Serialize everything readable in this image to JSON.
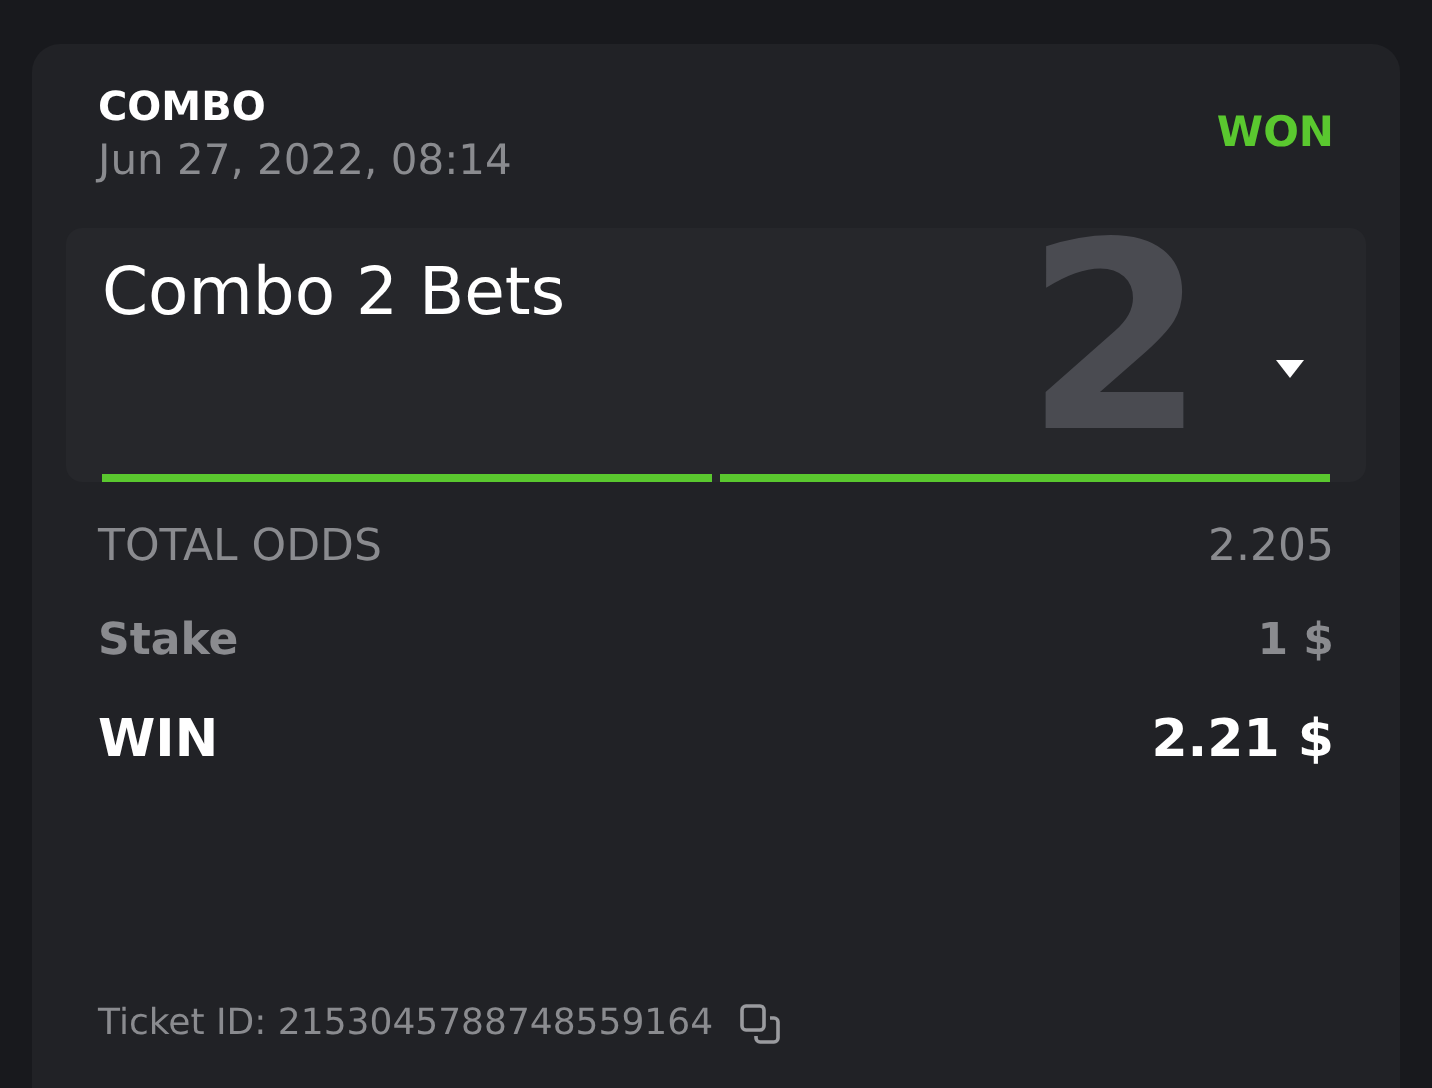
{
  "header": {
    "type": "COMBO",
    "date": "Jun 27, 2022, 08:14",
    "status": {
      "label": "WON",
      "kind": "won"
    }
  },
  "combo": {
    "title": "Combo 2 Bets",
    "count": "2",
    "expanded": false,
    "legs": [
      {
        "color": "#5ac82f"
      },
      {
        "color": "#5ac82f"
      }
    ]
  },
  "rows": [
    {
      "kind": "odds",
      "label": "TOTAL ODDS",
      "value": "2.205"
    },
    {
      "kind": "stake",
      "label": "Stake",
      "value": "1 $"
    },
    {
      "kind": "win",
      "label": "WIN",
      "value": "2.21 $"
    }
  ],
  "ticket": {
    "text": "Ticket ID: 2153045788748559164"
  }
}
